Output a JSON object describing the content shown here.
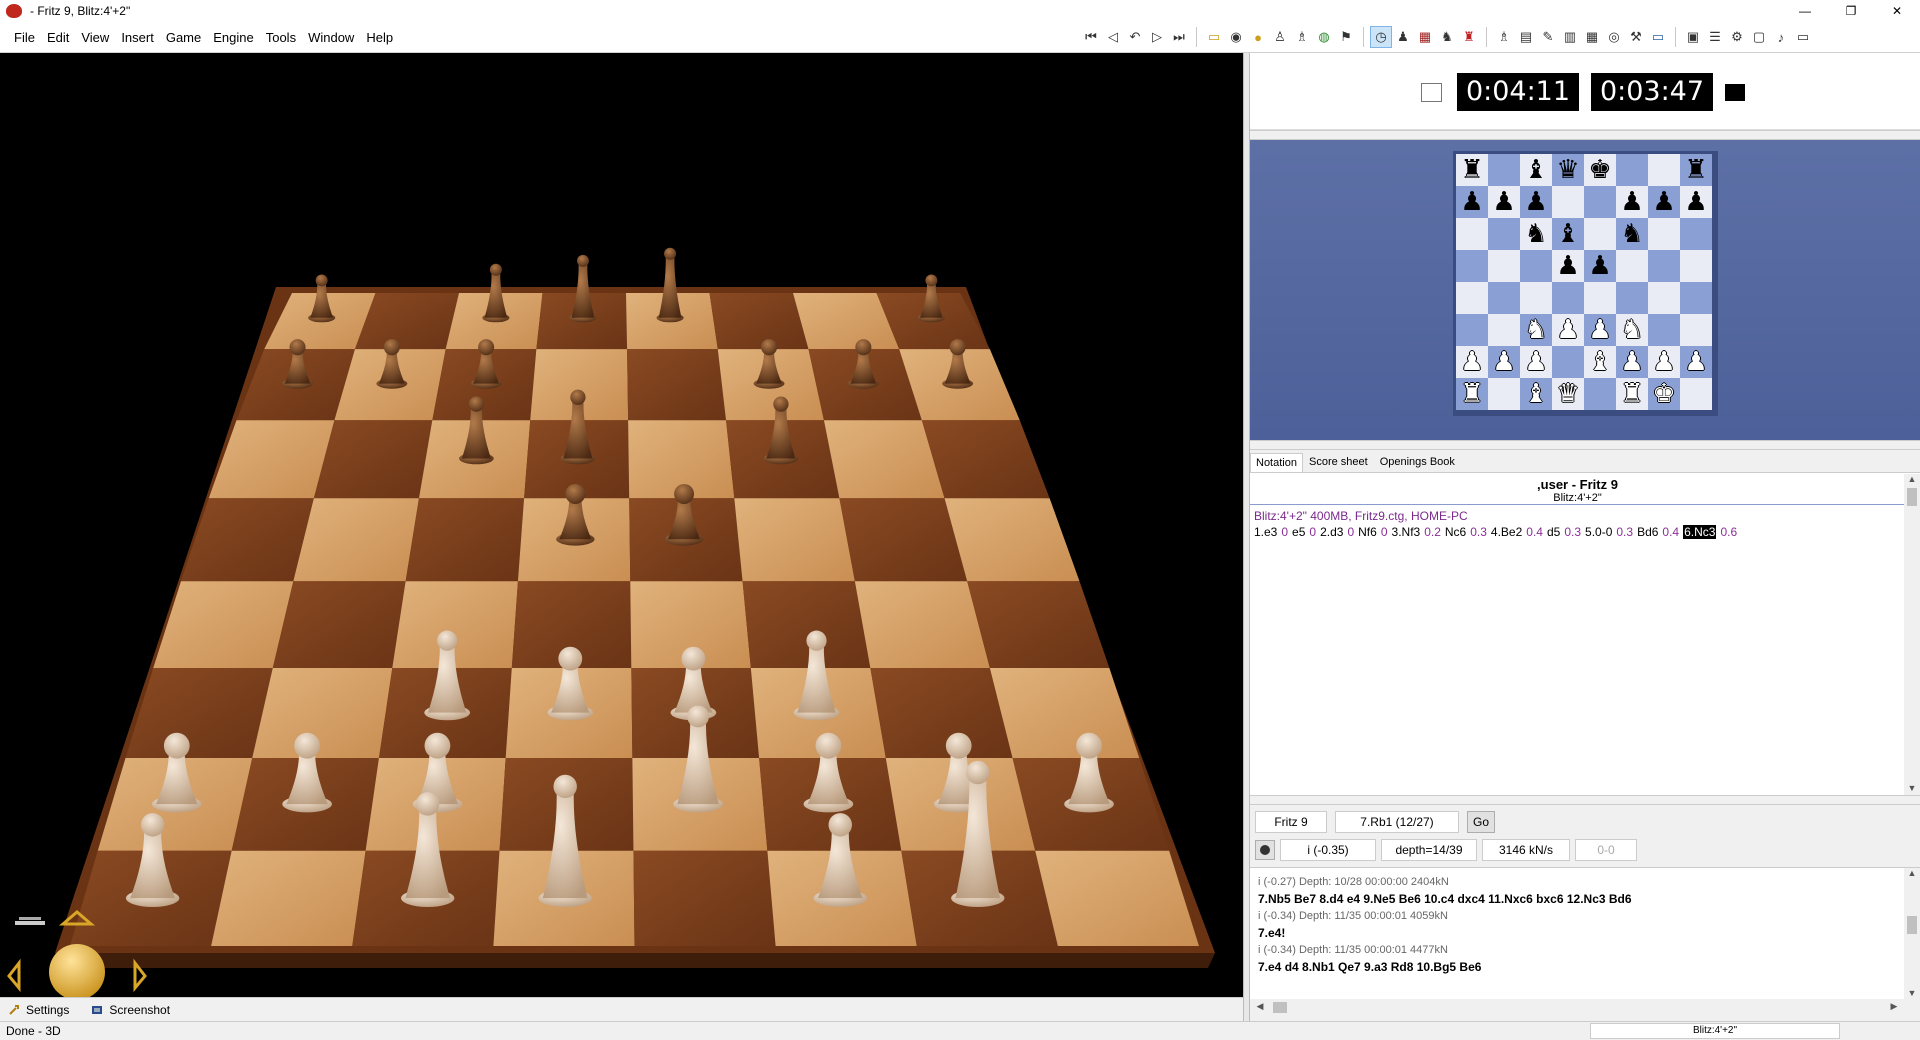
{
  "window": {
    "title": "- Fritz 9, Blitz:4'+2\"",
    "controls": [
      "—",
      "❐",
      "✕"
    ]
  },
  "menu": [
    "File",
    "Edit",
    "View",
    "Insert",
    "Game",
    "Engine",
    "Tools",
    "Window",
    "Help"
  ],
  "toolbar": {
    "nav_icons": [
      "first-move-icon",
      "back-icon",
      "take-back-icon",
      "forward-icon",
      "last-move-icon"
    ],
    "game_icons": [
      "open-database-icon",
      "new-game-icon",
      "engine-icon",
      "analysis-icon",
      "trainer-icon",
      "globe-icon",
      "flag-icon"
    ],
    "mode_icons": [
      "clock-icon",
      "pawn-icon",
      "board-icon",
      "move-piece-icon",
      "monster-icon"
    ],
    "tool_icons": [
      "hint-icon",
      "book-icon",
      "annotate-icon",
      "edit-position-icon",
      "grid-icon",
      "explorer-icon",
      "tools-icon",
      "chat-icon"
    ],
    "file_icons": [
      "save-icon",
      "layout-icon",
      "settings-icon",
      "dialog-icon",
      "sound-icon",
      "screen-icon"
    ]
  },
  "clocks": {
    "white": "0:04:11",
    "black": "0:03:47"
  },
  "board2d": [
    [
      "r",
      "",
      "b",
      "q",
      "k",
      "",
      "",
      "r"
    ],
    [
      "p",
      "p",
      "p",
      "",
      "",
      "p",
      "p",
      "p"
    ],
    [
      "",
      "",
      "n",
      "b",
      "",
      "n",
      "",
      ""
    ],
    [
      "",
      "",
      "",
      "p",
      "p",
      "",
      "",
      ""
    ],
    [
      "",
      "",
      "",
      "",
      "",
      "",
      "",
      ""
    ],
    [
      "",
      "",
      "N",
      "P",
      "P",
      "N",
      "",
      ""
    ],
    [
      "P",
      "P",
      "P",
      "",
      "B",
      "P",
      "P",
      "P"
    ],
    [
      "R",
      "",
      "B",
      "Q",
      "",
      "R",
      "K",
      ""
    ]
  ],
  "notation": {
    "tabs": [
      "Notation",
      "Score sheet",
      "Openings Book"
    ],
    "active_tab": 0,
    "game_title": ",user - Fritz 9",
    "game_sub": "Blitz:4'+2\"",
    "header": "Blitz:4'+2\"  400MB, Fritz9.ctg, HOME-PC",
    "moves": [
      {
        "m": "1.e3",
        "e": "0"
      },
      {
        "m": "e5",
        "e": "0"
      },
      {
        "m": "2.d3",
        "e": "0"
      },
      {
        "m": "Nf6",
        "e": "0"
      },
      {
        "m": "3.Nf3",
        "e": "0.2"
      },
      {
        "m": "Nc6",
        "e": "0.3"
      },
      {
        "m": "4.Be2",
        "e": "0.4"
      },
      {
        "m": "d5",
        "e": "0.3"
      },
      {
        "m": "5.0-0",
        "e": "0.3"
      },
      {
        "m": "Bd6",
        "e": "0.4"
      },
      {
        "m": "6.Nc3",
        "e": "0.6",
        "current": true
      }
    ]
  },
  "engine": {
    "name": "Fritz 9",
    "current_move": "7.Rb1 (12/27)",
    "go_label": "Go",
    "eval": "i  (-0.35)",
    "depth": "depth=14/39",
    "speed": "3146 kN/s",
    "score": "0-0",
    "lines": [
      {
        "info": "i  (-0.27)  Depth: 10/28   00:00:00  2404kN",
        "pv": "7.Nb5 Be7 8.d4 e4 9.Ne5 Be6 10.c4 dxc4 11.Nxc6 bxc6 12.Nc3 Bd6"
      },
      {
        "info": "i  (-0.34)  Depth: 11/35   00:00:01  4059kN",
        "pv": "7.e4!"
      },
      {
        "info": "i  (-0.34)  Depth: 11/35   00:00:01  4477kN",
        "pv": "7.e4 d4 8.Nb1 Qe7 9.a3 Rd8 10.Bg5 Be6"
      }
    ]
  },
  "bottom_bar": {
    "settings_label": "Settings",
    "screenshot_label": "Screenshot"
  },
  "status": {
    "left": "Done - 3D",
    "right": "Blitz:4'+2\""
  },
  "colors": {
    "board_light": "#e9ecf5",
    "board_dark": "#8aa0d4",
    "panel_blue": "#5d70a6",
    "eval_purple": "#8b2f96"
  }
}
